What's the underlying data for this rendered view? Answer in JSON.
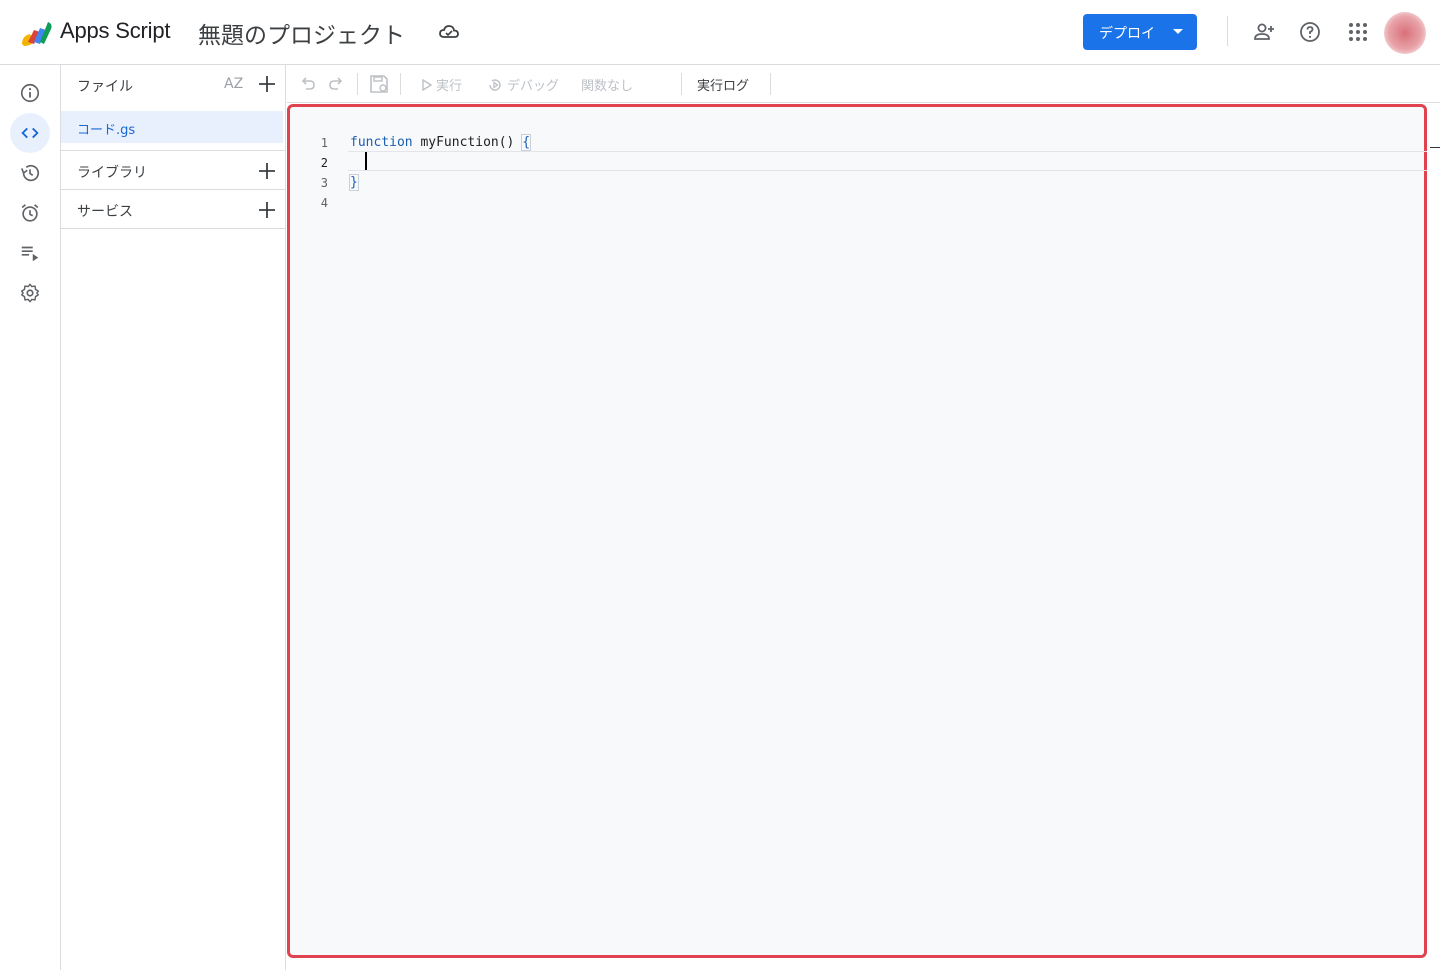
{
  "header": {
    "app_name": "Apps Script",
    "project_title": "無題のプロジェクト",
    "deploy_label": "デプロイ",
    "icons": [
      "cloud-icon",
      "add-person-icon",
      "help-icon",
      "apps-grid-icon"
    ]
  },
  "rail": {
    "items": [
      "info-icon",
      "code-icon",
      "history-icon",
      "alarm-icon",
      "executions-icon",
      "settings-icon"
    ],
    "active": "code-icon"
  },
  "files_panel": {
    "files_label": "ファイル",
    "sort_label": "AZ",
    "files": [
      "コード.gs"
    ],
    "libraries_label": "ライブラリ",
    "services_label": "サービス"
  },
  "toolbar": {
    "run_label": "実行",
    "debug_label": "デバッグ",
    "function_select": "関数なし",
    "log_label": "実行ログ"
  },
  "editor": {
    "line_numbers": [
      "1",
      "2",
      "3",
      "4"
    ],
    "line1_keyword": "function",
    "line1_name": "myFunction()",
    "line1_brace": "{",
    "line3_brace": "}"
  },
  "colors": {
    "accent": "#1a73e8",
    "highlight_border": "#e0434f",
    "active_bg": "#e8f0fe"
  }
}
